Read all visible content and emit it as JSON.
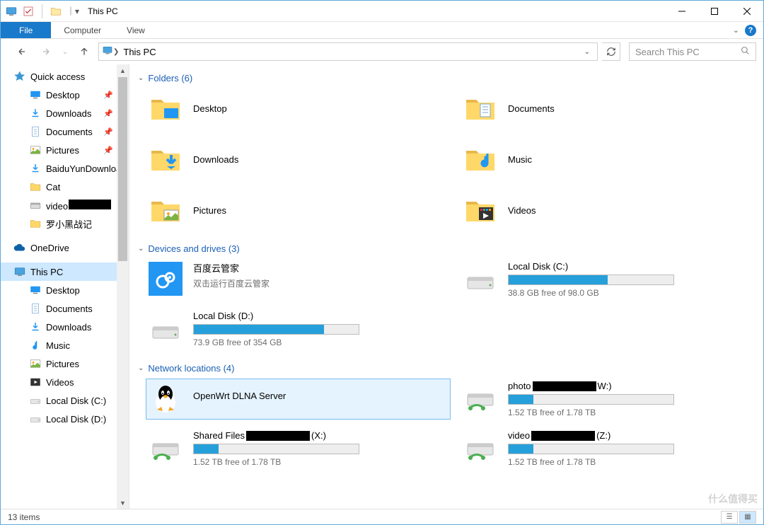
{
  "window": {
    "title": "This PC"
  },
  "ribbon": {
    "file": "File",
    "computer": "Computer",
    "view": "View"
  },
  "breadcrumb": {
    "location": "This PC"
  },
  "search": {
    "placeholder": "Search This PC"
  },
  "sidebar": {
    "quick_access": {
      "label": "Quick access",
      "items": [
        {
          "label": "Desktop",
          "pinned": true
        },
        {
          "label": "Downloads",
          "pinned": true
        },
        {
          "label": "Documents",
          "pinned": true
        },
        {
          "label": "Pictures",
          "pinned": true
        },
        {
          "label": "BaiduYunDownload",
          "pinned": false
        },
        {
          "label": "Cat",
          "pinned": false
        },
        {
          "label": "video",
          "pinned": false,
          "redacted": true
        },
        {
          "label": "罗小黑战记",
          "pinned": false
        }
      ]
    },
    "onedrive": {
      "label": "OneDrive"
    },
    "thispc": {
      "label": "This PC",
      "items": [
        {
          "label": "Desktop"
        },
        {
          "label": "Documents"
        },
        {
          "label": "Downloads"
        },
        {
          "label": "Music"
        },
        {
          "label": "Pictures"
        },
        {
          "label": "Videos"
        },
        {
          "label": "Local Disk (C:)"
        },
        {
          "label": "Local Disk (D:)"
        }
      ]
    }
  },
  "groups": {
    "folders": {
      "header": "Folders (6)",
      "items": [
        {
          "label": "Desktop",
          "icon": "desktop"
        },
        {
          "label": "Documents",
          "icon": "documents"
        },
        {
          "label": "Downloads",
          "icon": "downloads"
        },
        {
          "label": "Music",
          "icon": "music"
        },
        {
          "label": "Pictures",
          "icon": "pictures"
        },
        {
          "label": "Videos",
          "icon": "videos"
        }
      ]
    },
    "devices": {
      "header": "Devices and drives (3)",
      "items": [
        {
          "label": "百度云管家",
          "sub": "双击运行百度云管家",
          "type": "app"
        },
        {
          "label": "Local Disk (C:)",
          "free": "38.8 GB free of 98.0 GB",
          "used_pct": 60,
          "type": "disk"
        },
        {
          "label": "Local Disk (D:)",
          "free": "73.9 GB free of 354 GB",
          "used_pct": 79,
          "type": "disk"
        }
      ]
    },
    "network": {
      "header": "Network locations (4)",
      "items": [
        {
          "label": "OpenWrt DLNA Server",
          "type": "media",
          "selected": true
        },
        {
          "label_prefix": "photo",
          "label_suffix": "W:)",
          "free": "1.52 TB free of 1.78 TB",
          "used_pct": 15,
          "type": "netdrive",
          "redacted": true
        },
        {
          "label_prefix": "Shared Files",
          "label_suffix": "(X:)",
          "free": "1.52 TB free of 1.78 TB",
          "used_pct": 15,
          "type": "netdrive",
          "redacted": true
        },
        {
          "label_prefix": "video",
          "label_suffix": "(Z:)",
          "free": "1.52 TB free of 1.78 TB",
          "used_pct": 15,
          "type": "netdrive",
          "redacted": true
        }
      ]
    }
  },
  "status": {
    "count": "13 items"
  },
  "watermark": "什么值得买"
}
